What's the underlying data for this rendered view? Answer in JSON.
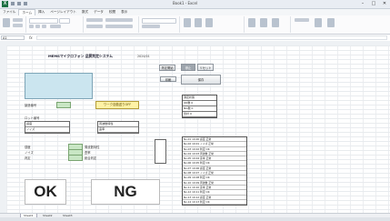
{
  "app": {
    "title": "Book1 - Excel"
  },
  "window_buttons": [
    "–",
    "□",
    "✕"
  ],
  "menu_tabs": [
    "ファイル",
    "ホーム",
    "挿入",
    "ページレイアウト",
    "数式",
    "データ",
    "校閲",
    "表示"
  ],
  "formula_bar": {
    "name_box": "A1",
    "fx": "fx",
    "value": ""
  },
  "sheet": {
    "title": "MEMSマイクロフォン 品質判定システム",
    "note": "2024/01",
    "yellow_label": "ワーク自動送りOFF",
    "serial_label": "製造番号",
    "lot_label": "ロット番号",
    "label_sens": "感度",
    "label_noise": "ノイズ",
    "label_judge": "判定",
    "label_freq": "周波数特性",
    "label_dist": "歪率",
    "label_total": "総合判定",
    "ok": "OK",
    "ng": "NG",
    "btn_start": "測定開始",
    "btn_stop": "停止",
    "btn_reset": "リセット",
    "btn_print": "印刷",
    "btn_save": "保存"
  },
  "status_grid": {
    "header": "測定状態",
    "rows": [
      "OK数 0",
      "NG数 0",
      "合計 0"
    ]
  },
  "log": [
    "No.01 10:00 感度 正常",
    "No.02 10:01 ノイズ 正常",
    "No.03 10:02 判定 OK",
    "No.04 10:03 周波数 正常",
    "No.05 10:04 歪率 正常",
    "No.06 10:05 判定 OK",
    "No.07 10:06 感度 正常",
    "No.08 10:07 ノイズ 正常",
    "No.09 10:08 判定 OK",
    "No.10 10:09 周波数 正常",
    "No.11 10:10 歪率 正常",
    "No.12 10:11 判定 OK",
    "No.13 10:12 感度 正常",
    "No.14 10:13 判定 OK"
  ],
  "sheet_tabs": [
    "Sheet1",
    "Sheet2",
    "Sheet3"
  ]
}
